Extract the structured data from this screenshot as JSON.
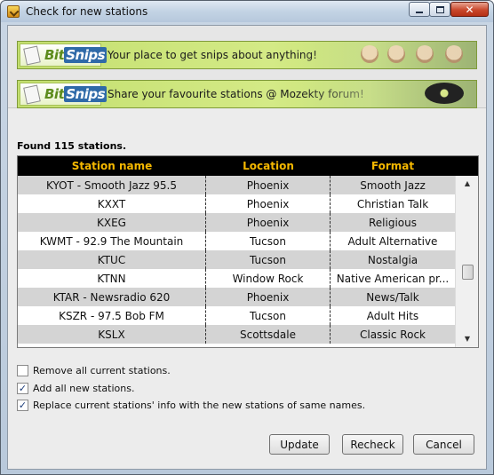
{
  "window": {
    "title": "Check for new stations",
    "minimize": "–",
    "maximize": "□",
    "close": "✕"
  },
  "banners": [
    {
      "logo_left": "Bit",
      "logo_right": "Snips",
      "slogan": "Your place to get snips about anything!"
    },
    {
      "logo_left": "Bit",
      "logo_right": "Snips",
      "slogan": "Share your favourite stations @ Mozekty forum!"
    }
  ],
  "found_text": "Found 115 stations.",
  "table": {
    "headers": [
      "Station name",
      "Location",
      "Format"
    ],
    "rows": [
      [
        "KYOT - Smooth Jazz 95.5",
        "Phoenix",
        "Smooth Jazz"
      ],
      [
        "KXXT",
        "Phoenix",
        "Christian Talk"
      ],
      [
        "KXEG",
        "Phoenix",
        "Religious"
      ],
      [
        "KWMT - 92.9 The Mountain",
        "Tucson",
        "Adult Alternative"
      ],
      [
        "KTUC",
        "Tucson",
        "Nostalgia"
      ],
      [
        "KTNN",
        "Window Rock",
        "Native American pr..."
      ],
      [
        "KTAR - Newsradio 620",
        "Phoenix",
        "News/Talk"
      ],
      [
        "KSZR - 97.5 Bob FM",
        "Tucson",
        "Adult Hits"
      ],
      [
        "KSLX",
        "Scottsdale",
        "Classic Rock"
      ]
    ],
    "scroll_up": "▲",
    "scroll_down": "▼"
  },
  "options": [
    {
      "label": "Remove all current stations.",
      "checked": false,
      "mark": ""
    },
    {
      "label": "Add all new stations.",
      "checked": true,
      "mark": "✓"
    },
    {
      "label": "Replace current stations' info with the new stations of same names.",
      "checked": true,
      "mark": "✓"
    }
  ],
  "buttons": {
    "update": "Update",
    "recheck": "Recheck",
    "cancel": "Cancel"
  },
  "colors": {
    "header_bg": "#000000",
    "header_text": "#f5b800",
    "banner_green": "#c3df6f"
  }
}
